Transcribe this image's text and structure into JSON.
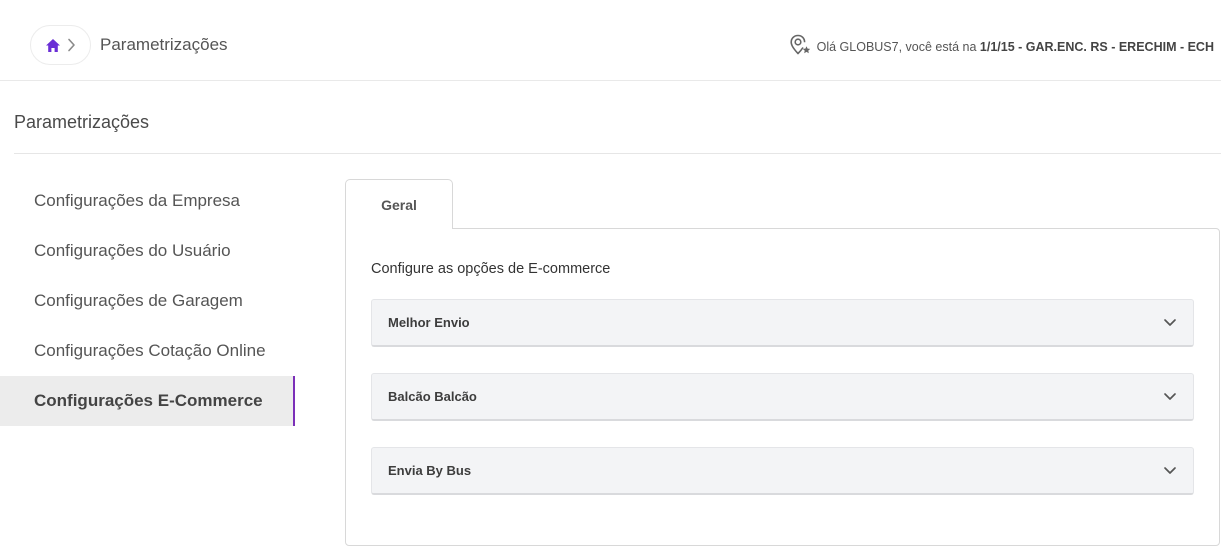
{
  "header": {
    "breadcrumb_title": "Parametrizações",
    "greeting": "Olá GLOBUS7, você está na",
    "location_bold": "1/1/15 - GAR.ENC. RS - ERECHIM - ECH",
    "accent": "#6a2fd6"
  },
  "page": {
    "title": "Parametrizações"
  },
  "sidebar": {
    "items": [
      {
        "label": "Configurações da Empresa"
      },
      {
        "label": "Configurações do Usuário"
      },
      {
        "label": "Configurações de Garagem"
      },
      {
        "label": "Configurações Cotação Online"
      },
      {
        "label": "Configurações E-Commerce"
      }
    ],
    "active_index": 4,
    "active_color": "#7b2fb8"
  },
  "main": {
    "tabs": [
      {
        "label": "Geral"
      }
    ],
    "description": "Configure as opções de E-commerce",
    "accordions": [
      {
        "label": "Melhor Envio",
        "icon": "chevron-down-icon"
      },
      {
        "label": "Balcão Balcão",
        "icon": "chevron-down-icon"
      },
      {
        "label": "Envia By Bus",
        "icon": "chevron-down-icon"
      }
    ]
  }
}
